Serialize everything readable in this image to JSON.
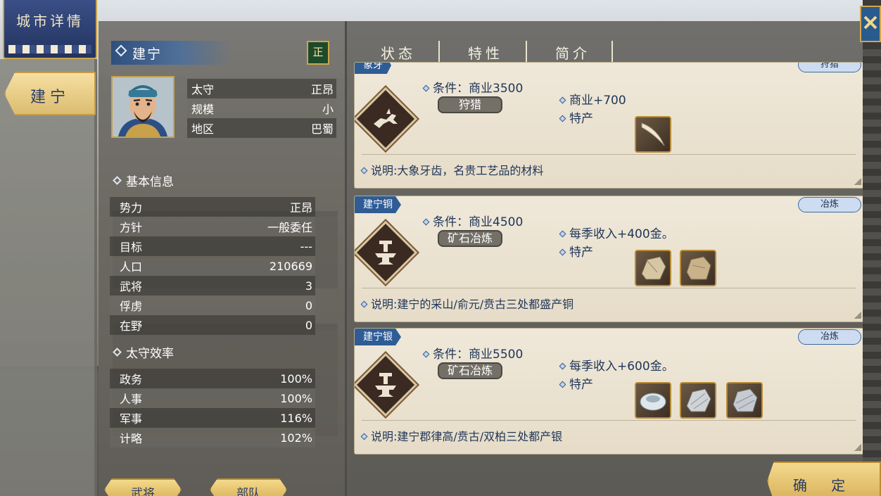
{
  "left_rail": {
    "title": "城市详情",
    "city_tab": "建宁"
  },
  "city": {
    "name": "建宁",
    "badge": "正",
    "overview": [
      {
        "label": "太守",
        "value": "正昂"
      },
      {
        "label": "规模",
        "value": "小"
      },
      {
        "label": "地区",
        "value": "巴蜀"
      }
    ]
  },
  "basic": {
    "title": "基本信息",
    "rows": [
      {
        "label": "势力",
        "value": "正昂"
      },
      {
        "label": "方针",
        "value": "一般委任"
      },
      {
        "label": "目标",
        "value": "---"
      },
      {
        "label": "人口",
        "value": "210669"
      },
      {
        "label": "武将",
        "value": "3"
      },
      {
        "label": "俘虏",
        "value": "0"
      },
      {
        "label": "在野",
        "value": "0"
      }
    ]
  },
  "efficiency": {
    "title": "太守效率",
    "rows": [
      {
        "label": "政务",
        "value": "100%"
      },
      {
        "label": "人事",
        "value": "100%"
      },
      {
        "label": "军事",
        "value": "116%"
      },
      {
        "label": "计略",
        "value": "102%"
      }
    ]
  },
  "bottom_buttons": {
    "generals": "武将",
    "troops": "部队"
  },
  "tabs": [
    "状态",
    "特性",
    "简介"
  ],
  "active_tab": "特性",
  "cards": [
    {
      "name": "象牙",
      "category": "狩猎",
      "condition": "条件：商业3500",
      "industry": "狩猎",
      "effect": "商业+700",
      "product_label": "特产",
      "products": [
        "ivory-icon"
      ],
      "description": "说明:大象牙齿，名贵工艺品的材料"
    },
    {
      "name": "建宁铜",
      "category": "冶炼",
      "condition": "条件：商业4500",
      "industry": "矿石冶炼",
      "effect": "每季收入+400金。",
      "product_label": "特产",
      "products": [
        "copper-ore-icon",
        "copper-ore-icon"
      ],
      "description": "说明:建宁的采山/俞元/贲古三处都盛产铜"
    },
    {
      "name": "建宁银",
      "category": "冶炼",
      "condition": "条件：商业5500",
      "industry": "矿石冶炼",
      "effect": "每季收入+600金。",
      "product_label": "特产",
      "products": [
        "silver-ingot-icon",
        "silver-ore-icon",
        "silver-ore-icon"
      ],
      "description": "说明:建宁郡律高/贲古/双柏三处都产银"
    }
  ],
  "confirm": "确 定"
}
